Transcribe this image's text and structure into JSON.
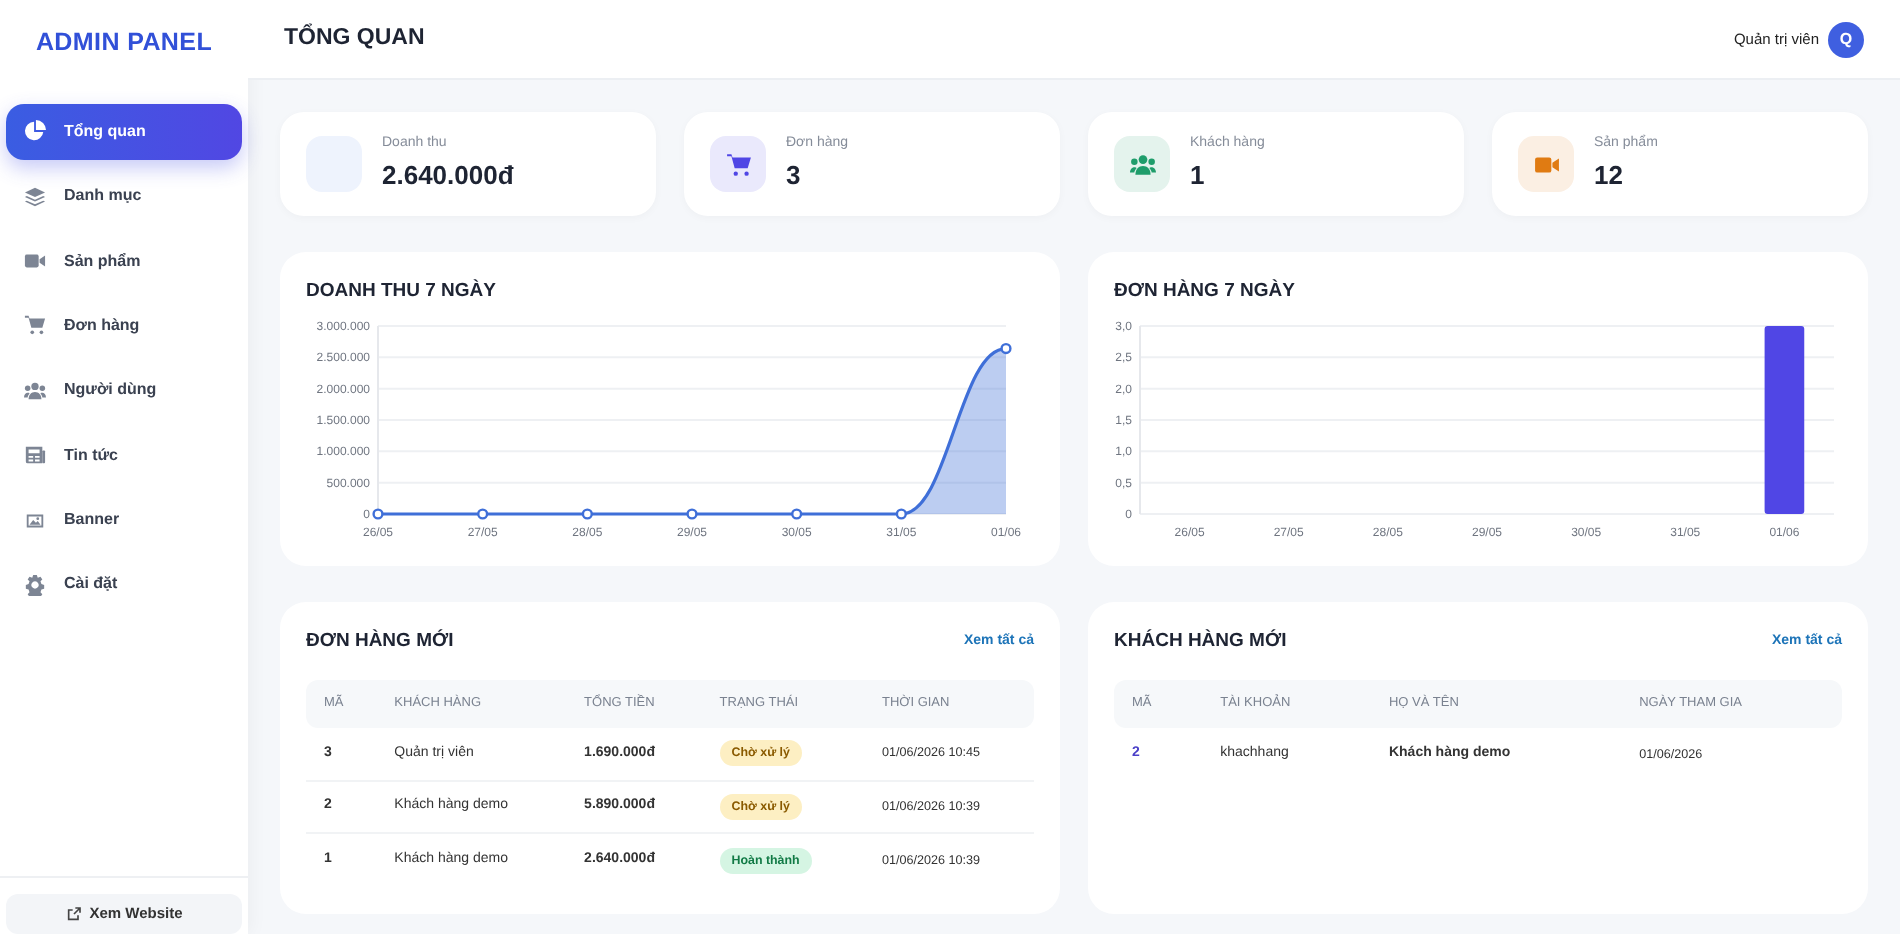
{
  "sidebar": {
    "brand": "ADMIN PANEL",
    "items": [
      {
        "label": "Tổng quan",
        "kind": "pie",
        "selected": true
      },
      {
        "label": "Danh mục",
        "kind": "layers",
        "selected": false
      },
      {
        "label": "Sản phẩm",
        "kind": "video",
        "selected": false
      },
      {
        "label": "Đơn hàng",
        "kind": "cart",
        "selected": false
      },
      {
        "label": "Người dùng",
        "kind": "users",
        "selected": false
      },
      {
        "label": "Tin tức",
        "kind": "news",
        "selected": false
      },
      {
        "label": "Banner",
        "kind": "image",
        "selected": false
      },
      {
        "label": "Cài đặt",
        "kind": "gear",
        "selected": false
      }
    ],
    "footer_link": "Xem Website"
  },
  "header": {
    "title": "TỔNG QUAN",
    "user_role": "Quản trị viên",
    "avatar_initial": "Q"
  },
  "stats": [
    {
      "label": "Doanh thu",
      "value": "2.640.000đ",
      "kind": "blank",
      "color": "#eef3fd"
    },
    {
      "label": "Đơn hàng",
      "value": "3",
      "kind": "cart",
      "color": "#5046e5"
    },
    {
      "label": "Khách hàng",
      "value": "1",
      "kind": "users",
      "color": "#1f9d6b"
    },
    {
      "label": "Sản phẩm",
      "value": "12",
      "kind": "video",
      "color": "#e07b12"
    }
  ],
  "revenue_chart": {
    "title": "DOANH THU 7 NGÀY",
    "chart_data": {
      "type": "area",
      "categories": [
        "26/05",
        "27/05",
        "28/05",
        "29/05",
        "30/05",
        "31/05",
        "01/06"
      ],
      "series": [
        {
          "color": "#3f6fd8",
          "values": [
            0,
            0,
            0,
            0,
            0,
            0,
            2640000
          ]
        }
      ],
      "ylim": [
        0,
        3000000
      ],
      "grid": true,
      "yticks": [
        {
          "value": 0,
          "label": "0"
        },
        {
          "value": 500000,
          "label": "500.000"
        },
        {
          "value": 1000000,
          "label": "1.000.000"
        },
        {
          "value": 1500000,
          "label": "1.500.000"
        },
        {
          "value": 2000000,
          "label": "2.000.000"
        },
        {
          "value": 2500000,
          "label": "2.500.000"
        },
        {
          "value": 3000000,
          "label": "3.000.000"
        }
      ]
    }
  },
  "orders_chart": {
    "title": "ĐƠN HÀNG 7 NGÀY",
    "chart_data": {
      "type": "bar",
      "categories": [
        "26/05",
        "27/05",
        "28/05",
        "29/05",
        "30/05",
        "31/05",
        "01/06"
      ],
      "series": [
        {
          "color": "#5046e5",
          "values": [
            0,
            0,
            0,
            0,
            0,
            0,
            3
          ]
        }
      ],
      "ylim": [
        0,
        3
      ],
      "grid": true,
      "yticks": [
        {
          "value": 0,
          "label": "0"
        },
        {
          "value": 0.5,
          "label": "0,5"
        },
        {
          "value": 1,
          "label": "1,0"
        },
        {
          "value": 1.5,
          "label": "1,5"
        },
        {
          "value": 2,
          "label": "2,0"
        },
        {
          "value": 2.5,
          "label": "2,5"
        },
        {
          "value": 3,
          "label": "3,0"
        }
      ]
    }
  },
  "new_orders": {
    "title": "ĐƠN HÀNG MỚI",
    "view_all": "Xem tất cả",
    "columns": [
      "MÃ",
      "KHÁCH HÀNG",
      "TỔNG TIỀN",
      "TRẠNG THÁI",
      "THỜI GIAN"
    ],
    "rows": [
      {
        "id": "3",
        "customer": "Quản trị viên",
        "total": "1.690.000đ",
        "status": "Chờ xử lý",
        "kind": "pending",
        "time": "01/06/2026 10:45"
      },
      {
        "id": "2",
        "customer": "Khách hàng demo",
        "total": "5.890.000đ",
        "status": "Chờ xử lý",
        "kind": "pending",
        "time": "01/06/2026 10:39"
      },
      {
        "id": "1",
        "customer": "Khách hàng demo",
        "total": "2.640.000đ",
        "status": "Hoàn thành",
        "kind": "done",
        "time": "01/06/2026 10:39"
      }
    ]
  },
  "new_customers": {
    "title": "KHÁCH HÀNG MỚI",
    "view_all": "Xem tất cả",
    "columns": [
      "MÃ",
      "TÀI KHOẢN",
      "HỌ VÀ TÊN",
      "NGÀY THAM GIA"
    ],
    "rows": [
      {
        "id": "2",
        "username": "khachhang",
        "full_name": "Khách hàng demo",
        "joined": "01/06/2026"
      }
    ]
  }
}
